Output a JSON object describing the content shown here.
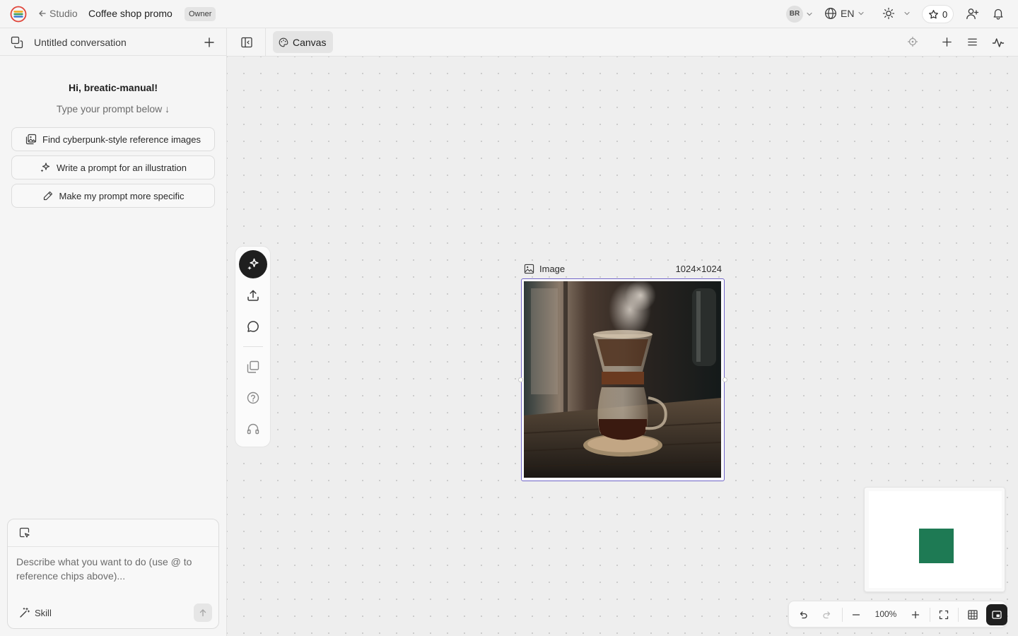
{
  "topbar": {
    "back_label": "Studio",
    "project_title": "Coffee shop promo",
    "role_badge": "Owner",
    "user_initials": "BR",
    "language": "EN",
    "credits": "0"
  },
  "sidebar": {
    "conversation_title": "Untitled conversation",
    "greeting": "Hi, breatic-manual!",
    "subgreeting": "Type your prompt below ↓",
    "suggestions": [
      {
        "label": "Find cyberpunk-style reference images",
        "icon": "image-gallery-icon"
      },
      {
        "label": "Write a prompt for an illustration",
        "icon": "sparkles-icon"
      },
      {
        "label": "Make my prompt more specific",
        "icon": "pencil-icon"
      }
    ],
    "composer": {
      "placeholder": "Describe what you want to do (use @ to reference chips above)...",
      "skill_label": "Skill"
    }
  },
  "canvas_header": {
    "tab_label": "Canvas"
  },
  "canvas": {
    "node": {
      "type_label": "Image",
      "dimensions": "1024×1024",
      "content": "Pour-over coffee brewer on a wooden table with steam"
    },
    "zoom_level": "100%"
  },
  "colors": {
    "selection": "#6e63c7",
    "minimap_node": "#1e7a54",
    "primary_dark": "#1f1f1f"
  }
}
